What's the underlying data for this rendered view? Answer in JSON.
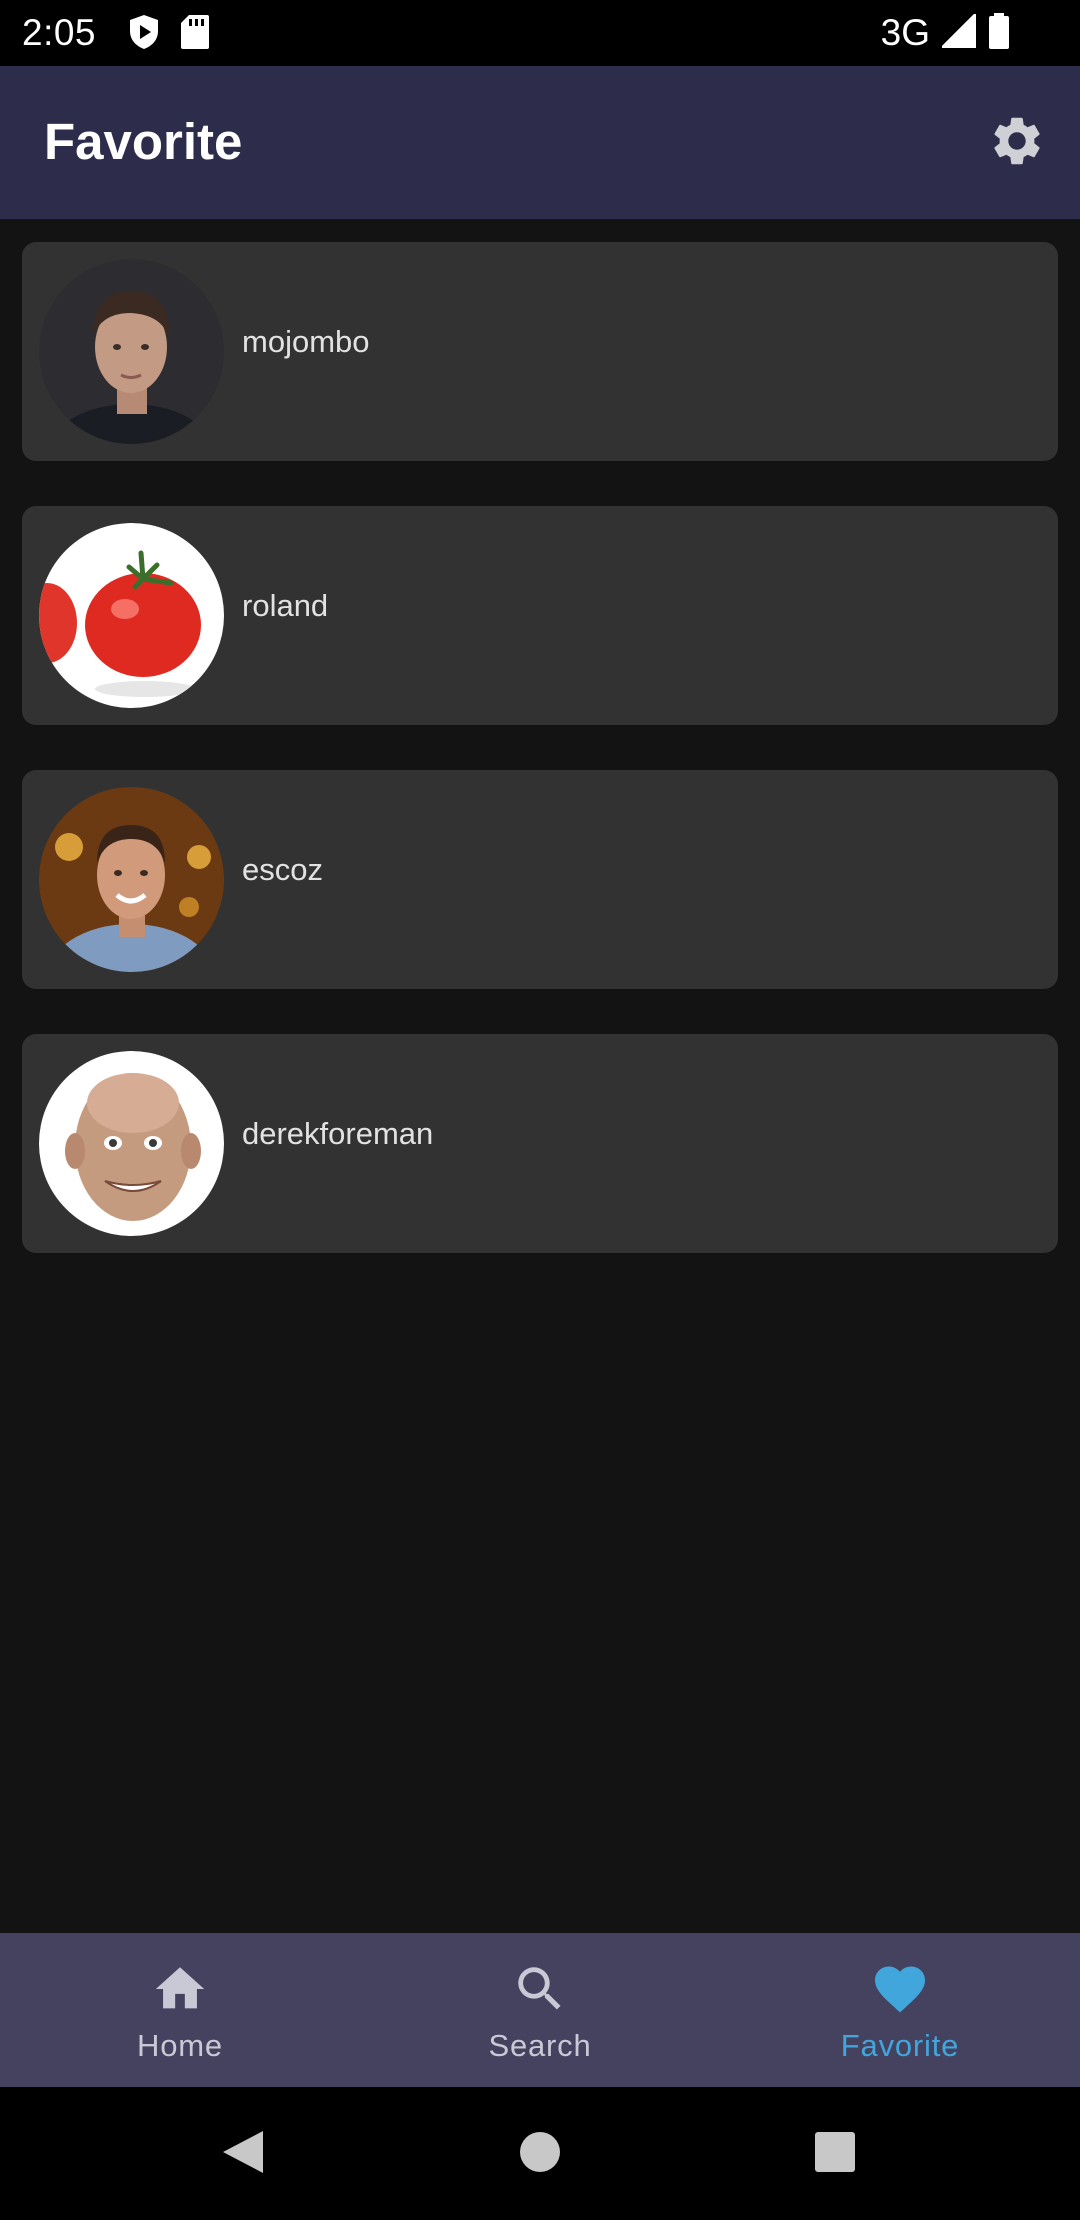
{
  "status_bar": {
    "time": "2:05",
    "network": "3G",
    "icons": [
      "play-protect-icon",
      "sd-card-icon",
      "signal-icon",
      "battery-icon"
    ]
  },
  "app_bar": {
    "title": "Favorite",
    "settings_icon": "gear-icon"
  },
  "favorites": [
    {
      "username": "mojombo",
      "avatar": "person-photo"
    },
    {
      "username": "roland",
      "avatar": "tomato-photo"
    },
    {
      "username": "escoz",
      "avatar": "person-photo"
    },
    {
      "username": "derekforeman",
      "avatar": "person-photo"
    }
  ],
  "bottom_nav": {
    "items": [
      {
        "label": "Home",
        "icon": "home-icon",
        "active": false
      },
      {
        "label": "Search",
        "icon": "search-icon",
        "active": false
      },
      {
        "label": "Favorite",
        "icon": "heart-icon",
        "active": true
      }
    ]
  },
  "colors": {
    "app_bar": "#2e2c4b",
    "background": "#131313",
    "card": "#323232",
    "bottom_nav": "#44425f",
    "accent": "#41a6dc"
  },
  "system_nav": {
    "buttons": [
      "back-icon",
      "home-circle-icon",
      "recents-icon"
    ]
  }
}
